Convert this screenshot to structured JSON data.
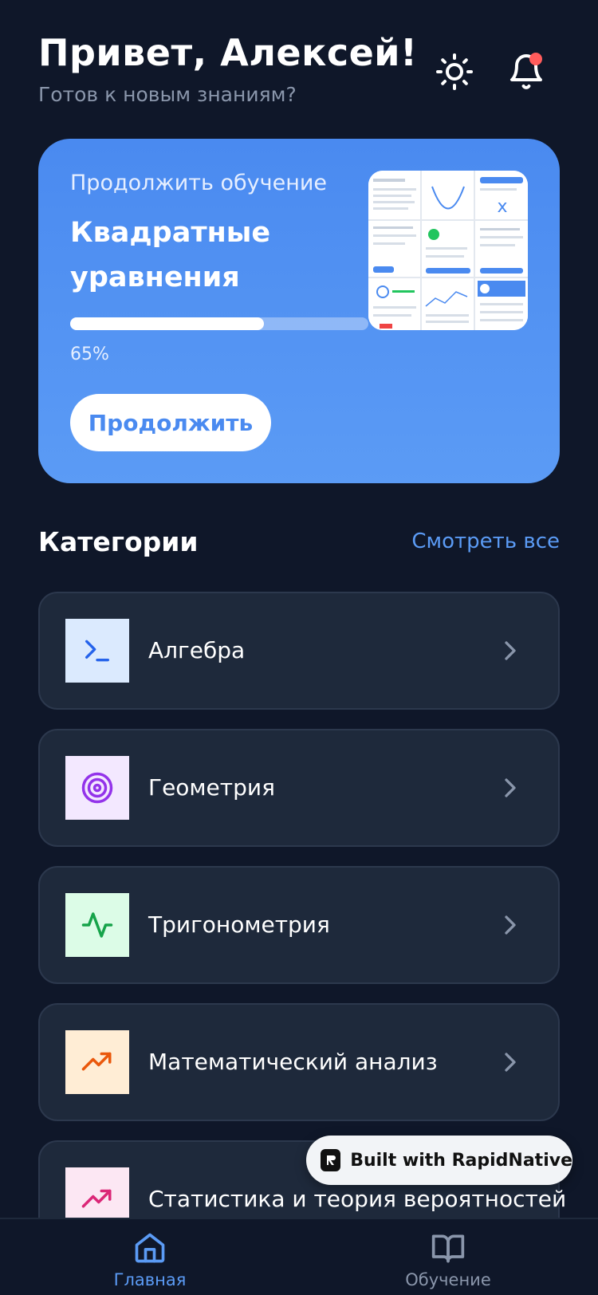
{
  "header": {
    "greeting": "Привет, Алексей!",
    "subtitle": "Готов к новым знаниям?",
    "theme_icon": "sun-icon",
    "notification_icon": "bell-icon",
    "has_notification": true
  },
  "continue_card": {
    "label": "Продолжить обучение",
    "title": "Квадратные уравнения",
    "progress": 0.65,
    "progress_text": "65%",
    "button_label": "Продолжить"
  },
  "categories": {
    "title": "Категории",
    "see_all": "Смотреть все",
    "items": [
      {
        "label": "Алгебра",
        "icon": "terminal-icon",
        "icon_color": "#2563eb",
        "icon_bg": "#dbeafe"
      },
      {
        "label": "Геометрия",
        "icon": "target-icon",
        "icon_color": "#9333ea",
        "icon_bg": "#f3e8ff"
      },
      {
        "label": "Тригонометрия",
        "icon": "activity-icon",
        "icon_color": "#16a34a",
        "icon_bg": "#dcfce7"
      },
      {
        "label": "Математический анализ",
        "icon": "trending-up-icon",
        "icon_color": "#ea580c",
        "icon_bg": "#ffedd5"
      },
      {
        "label": "Статистика и теория вероятностей",
        "icon": "trending-up-icon",
        "icon_color": "#db2777",
        "icon_bg": "#fce7f3"
      }
    ]
  },
  "badge": {
    "text": "Built with RapidNative"
  },
  "bottom_nav": {
    "items": [
      {
        "label": "Главная",
        "icon": "home-icon",
        "active": true
      },
      {
        "label": "Обучение",
        "icon": "book-open-icon",
        "active": false
      }
    ]
  },
  "colors": {
    "background": "#0f1729",
    "card": "#1e293b",
    "accent": "#5b9bf5",
    "muted": "#8a96ab",
    "notification": "#ff5c5c"
  }
}
